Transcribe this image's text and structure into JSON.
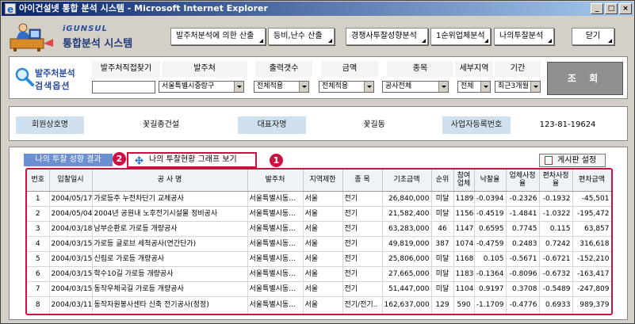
{
  "window": {
    "title": "아이건설넷 통합 분석 시스템 - Microsoft Internet Explorer"
  },
  "header": {
    "logo_sub": "iGUNSUL",
    "logo_main": "통합분석 시스템",
    "nav": [
      {
        "label": "발주처분석에 의한 산출"
      },
      {
        "label": "등비,난수 산출"
      },
      {
        "label": "경쟁사투찰성향분석"
      },
      {
        "label": "1순위업체분석"
      },
      {
        "label": "나의투찰분석"
      },
      {
        "label": "닫기"
      }
    ]
  },
  "search": {
    "label_line1": "발주처분석",
    "label_line2": "검색옵션",
    "headers": [
      "발주처직접찾기",
      "발주처",
      "출력갯수",
      "금액",
      "종목",
      "세부지역",
      "기간"
    ],
    "values": {
      "client": "서울특별시중랑구",
      "count": "전체적용",
      "amount": "전체적용",
      "category": "공사전체",
      "region": "전체",
      "period": "최근3개월"
    },
    "query_button": "조 회"
  },
  "company": {
    "name_label": "회원상호명",
    "name_value": "꽃길종건설",
    "ceo_label": "대표자명",
    "ceo_value": "꽃길동",
    "biz_label": "사업자등록번호",
    "biz_value": "123-81-19624"
  },
  "results": {
    "tab_label": "나의 투찰 성향 결과",
    "graph_button": "나의 투찰현황 그래프 보기",
    "board_button": "게시판 설정",
    "badge1": "1",
    "badge2": "2",
    "columns": [
      "번호",
      "입찰일시",
      "공 사 명",
      "발주처",
      "지역제한",
      "종 목",
      "기초금액",
      "순위",
      "참여업체",
      "낙찰율",
      "업체사정율",
      "편차사정율",
      "편차금액"
    ],
    "rows": [
      [
        "1",
        "2004/05/17",
        "가로등주 누전차단기 교체공사",
        "서울특별시동...",
        "서울",
        "전기",
        "26,840,000",
        "미달",
        "1189",
        "-0.0394",
        "-0.2326",
        "-0.1932",
        "-45,501"
      ],
      [
        "2",
        "2004/05/04",
        "2004년 공원내 노후전기시설물 정비공사",
        "서울특별시동...",
        "서울",
        "전기",
        "21,582,400",
        "미달",
        "1156",
        "-0.4519",
        "-1.4841",
        "-1.0322",
        "-195,472"
      ],
      [
        "3",
        "2004/03/18",
        "남부순환로 가로등 개량공사",
        "서울특별시동...",
        "서울",
        "전기",
        "63,283,000",
        "46",
        "1147",
        "0.6595",
        "0.7745",
        "0.115",
        "63,857"
      ],
      [
        "4",
        "2004/03/15",
        "가로등 글로브 세척공사(연간단가)",
        "서울특별시동...",
        "서울",
        "전기",
        "49,819,000",
        "387",
        "1074",
        "-0.4759",
        "0.2483",
        "0.7242",
        "316,618"
      ],
      [
        "5",
        "2004/03/15",
        "신림로 가로등 개량공사",
        "서울특별시동...",
        "서울",
        "전기",
        "25,806,000",
        "미달",
        "1168",
        "0.105",
        "-0.5671",
        "-0.6721",
        "-152,210"
      ],
      [
        "6",
        "2004/03/15",
        "학수10길 가로등 개량공사",
        "서울특별시동...",
        "서울",
        "전기",
        "27,665,000",
        "미달",
        "1183",
        "-0.1364",
        "-0.8096",
        "-0.6732",
        "-163,417"
      ],
      [
        "7",
        "2004/03/15",
        "동작우체국길 가로등 개량공사",
        "서울특별시동...",
        "서울",
        "전기",
        "51,447,000",
        "미달",
        "1104",
        "0.9197",
        "0.3708",
        "-0.5489",
        "-247,809"
      ],
      [
        "8",
        "2004/03/11",
        "동작자원봉사센타 신축 전기공사(정정)",
        "서울특별시동...",
        "서울",
        "전기/전기..",
        "162,637,000",
        "129",
        "590",
        "-1.1709",
        "-0.4776",
        "0.6933",
        "989,379"
      ]
    ]
  }
}
